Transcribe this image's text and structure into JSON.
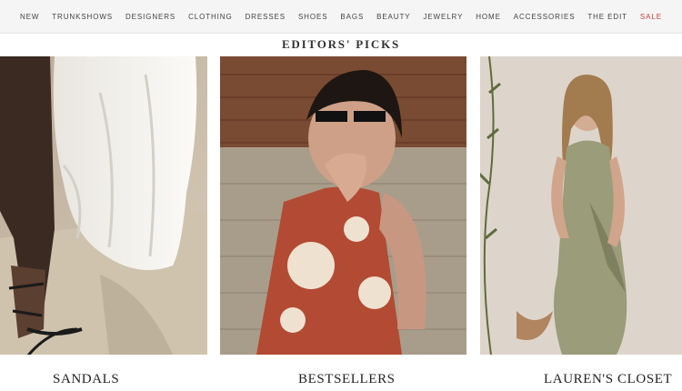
{
  "nav": {
    "items": [
      {
        "label": "NEW"
      },
      {
        "label": "TRUNKSHOWS"
      },
      {
        "label": "DESIGNERS"
      },
      {
        "label": "CLOTHING"
      },
      {
        "label": "DRESSES"
      },
      {
        "label": "SHOES"
      },
      {
        "label": "BAGS"
      },
      {
        "label": "BEAUTY"
      },
      {
        "label": "JEWELRY"
      },
      {
        "label": "HOME"
      },
      {
        "label": "ACCESSORIES"
      },
      {
        "label": "THE EDIT"
      },
      {
        "label": "SALE"
      }
    ],
    "sale_color": "#d23b3b"
  },
  "section": {
    "title": "EDITORS' PICKS"
  },
  "cards": [
    {
      "caption": "SANDALS"
    },
    {
      "caption": "BESTSELLERS"
    },
    {
      "caption": "LAUREN'S CLOSET"
    }
  ]
}
